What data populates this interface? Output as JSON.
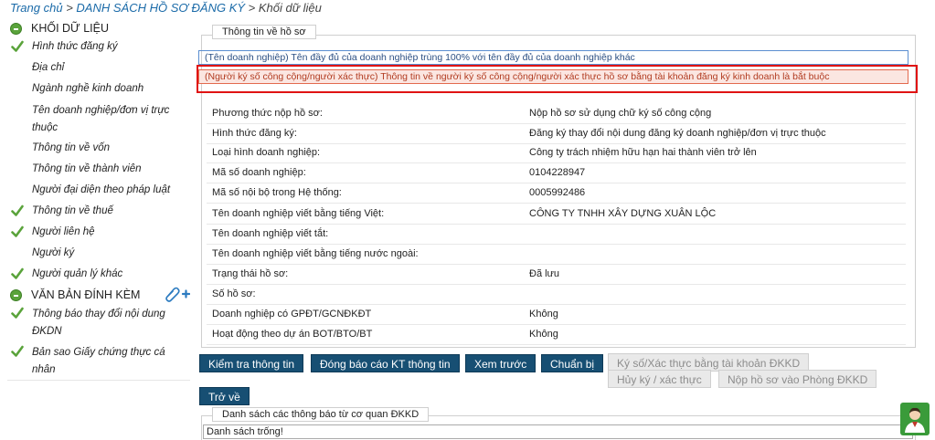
{
  "breadcrumb": {
    "home": "Trang chủ",
    "sep1": " > ",
    "list": "DANH SÁCH HỒ SƠ ĐĂNG KÝ",
    "sep2": " > ",
    "current": "Khối dữ liệu"
  },
  "sidebar": {
    "section1_title": "KHỐI DỮ LIỆU",
    "items": [
      {
        "label": "Hình thức đăng ký",
        "checked": true
      },
      {
        "label": "Địa chỉ",
        "checked": false
      },
      {
        "label": "Ngành nghề kinh doanh",
        "checked": false
      },
      {
        "label": "Tên doanh nghiệp/đơn vị trực thuộc",
        "checked": false
      },
      {
        "label": "Thông tin về vốn",
        "checked": false
      },
      {
        "label": "Thông tin về thành viên",
        "checked": false
      },
      {
        "label": "Người đại diện theo pháp luật",
        "checked": false
      },
      {
        "label": "Thông tin về thuế",
        "checked": true
      },
      {
        "label": "Người liên hệ",
        "checked": true
      },
      {
        "label": "Người ký",
        "checked": false
      },
      {
        "label": "Người quản lý khác",
        "checked": true
      }
    ],
    "section2_title": "VĂN BẢN ĐÍNH KÈM",
    "attachments": [
      {
        "label": "Thông báo thay đổi nội dung ĐKDN",
        "checked": true
      },
      {
        "label": "Bản sao Giấy chứng thực cá nhân",
        "checked": true
      }
    ]
  },
  "panel": {
    "legend": "Thông tin về hồ sơ",
    "notice_info": "(Tên doanh nghiệp) Tên đầy đủ của doanh nghiệp trùng 100% với tên đầy đủ của doanh nghiệp khác",
    "notice_error": "(Người ký số công cộng/người xác thực) Thông tin về người ký số công cộng/người xác thực hồ sơ bằng tài khoản đăng ký kinh doanh là bắt buộc",
    "rows": [
      {
        "label": "Phương thức nộp hồ sơ:",
        "value": "Nộp hồ sơ sử dụng chữ ký số công cộng"
      },
      {
        "label": "Hình thức đăng ký:",
        "value": "Đăng ký thay đổi nội dung đăng ký doanh nghiệp/đơn vị trực thuộc"
      },
      {
        "label": "Loại hình doanh nghiệp:",
        "value": "Công ty trách nhiệm hữu hạn hai thành viên trở lên"
      },
      {
        "label": "Mã số doanh nghiệp:",
        "value": "0104228947"
      },
      {
        "label": "Mã số nội bộ trong Hệ thống:",
        "value": "0005992486"
      },
      {
        "label": "Tên doanh nghiệp viết bằng tiếng Việt:",
        "value": "CÔNG TY TNHH XÂY DỰNG XUÂN LỘC"
      },
      {
        "label": "Tên doanh nghiệp viết tắt:",
        "value": ""
      },
      {
        "label": "Tên doanh nghiệp viết bằng tiếng nước ngoài:",
        "value": ""
      },
      {
        "label": "Trạng thái hồ sơ:",
        "value": "Đã lưu"
      },
      {
        "label": "Số hồ sơ:",
        "value": ""
      },
      {
        "label": "Doanh nghiệp có GPĐT/GCNĐKĐT",
        "value": "Không"
      },
      {
        "label": "Hoạt động theo dự án BOT/BTO/BT",
        "value": "Không"
      }
    ]
  },
  "buttons": {
    "check": "Kiểm tra thông tin",
    "report": "Đóng báo cáo KT thông tin",
    "preview": "Xem trước",
    "prepare": "Chuẩn bị",
    "sign": "Ký số/Xác thực bằng tài khoản ĐKKD",
    "cancel_sign": "Hủy ký / xác thực",
    "submit": "Nộp hồ sơ vào Phòng ĐKKD",
    "back": "Trở về"
  },
  "notices_panel": {
    "legend": "Danh sách các thông báo từ cơ quan ĐKKD",
    "empty": "Danh sách trống!"
  },
  "colors": {
    "primary_button": "#174f73",
    "check_green": "#5aa33b",
    "error_red": "#e01313",
    "link_blue": "#1a6aa8"
  }
}
